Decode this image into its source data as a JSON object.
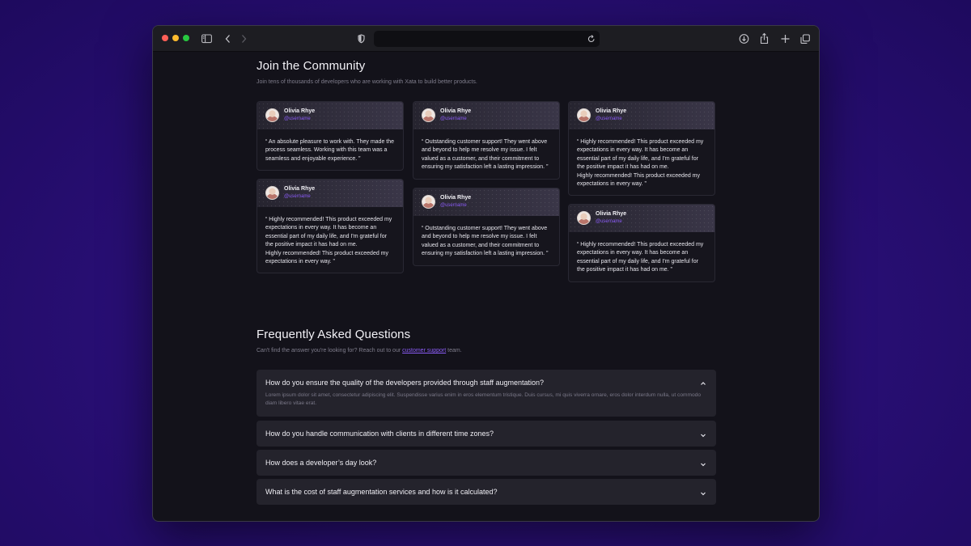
{
  "community": {
    "title": "Join the Community",
    "subtitle": "Join tens of thousands of developers who are working with Xata to build better products.",
    "testimonials": [
      {
        "name": "Olivia Rhye",
        "handle": "@username",
        "quote": "“ An absolute pleasure to work with. They made the process seamless. Working with this team was a seamless and enjoyable experience. ”"
      },
      {
        "name": "Olivia Rhye",
        "handle": "@username",
        "quote": "“ Highly recommended! This product exceeded my expectations in every way. It has become an essential part of my daily life, and I'm grateful for the positive impact it has had on me.\nHighly recommended! This product exceeded my expectations in every way. ”"
      },
      {
        "name": "Olivia Rhye",
        "handle": "@username",
        "quote": "“ Outstanding customer support! They went above and beyond to help me resolve my issue. I felt valued as a customer, and their commitment to ensuring my satisfaction left a lasting impression. ”"
      },
      {
        "name": "Olivia Rhye",
        "handle": "@username",
        "quote": "“ Outstanding customer support! They went above and beyond to help me resolve my issue. I felt valued as a customer, and their commitment to ensuring my satisfaction left a lasting impression. ”"
      },
      {
        "name": "Olivia Rhye",
        "handle": "@username",
        "quote": "“ Highly recommended! This product exceeded my expectations in every way. It has become an essential part of my daily life, and I'm grateful for the positive impact it has had on me.\nHighly recommended! This product exceeded my expectations in every way. ”"
      },
      {
        "name": "Olivia Rhye",
        "handle": "@username",
        "quote": "“ Highly recommended! This product exceeded my expectations in every way. It has become an essential part of my daily life, and I'm grateful for the positive impact it has had on me. ”"
      }
    ]
  },
  "faq": {
    "title": "Frequently Asked Questions",
    "subtitle_before": "Can't find the answer you're looking for? Reach out to our ",
    "subtitle_link": "customer support",
    "subtitle_after": " team.",
    "items": [
      {
        "question": "How do you ensure the quality of the developers provided through staff augmentation?",
        "answer": "Lorem ipsum dolor sit amet, consectetur adipiscing elit. Suspendisse varius enim in eros elementum tristique. Duis cursus, mi quis viverra ornare, eros dolor interdum nulla, ut commodo diam libero vitae erat.",
        "expanded": true
      },
      {
        "question": "How do you handle communication with clients in different time zones?",
        "expanded": false
      },
      {
        "question": "How does a developer’s day look?",
        "expanded": false
      },
      {
        "question": "What is the cost of staff augmentation services and how is it calculated?",
        "expanded": false
      }
    ]
  },
  "colors": {
    "accent": "#8b5cf6",
    "background": "#13121a",
    "card": "#16151d",
    "faq_item": "#24232c"
  },
  "icons": [
    "sidebar-icon",
    "back-icon",
    "forward-icon",
    "shield-icon",
    "reload-icon",
    "download-icon",
    "share-icon",
    "new-tab-icon",
    "tabs-overview-icon",
    "chevron-up-icon",
    "chevron-down-icon"
  ]
}
